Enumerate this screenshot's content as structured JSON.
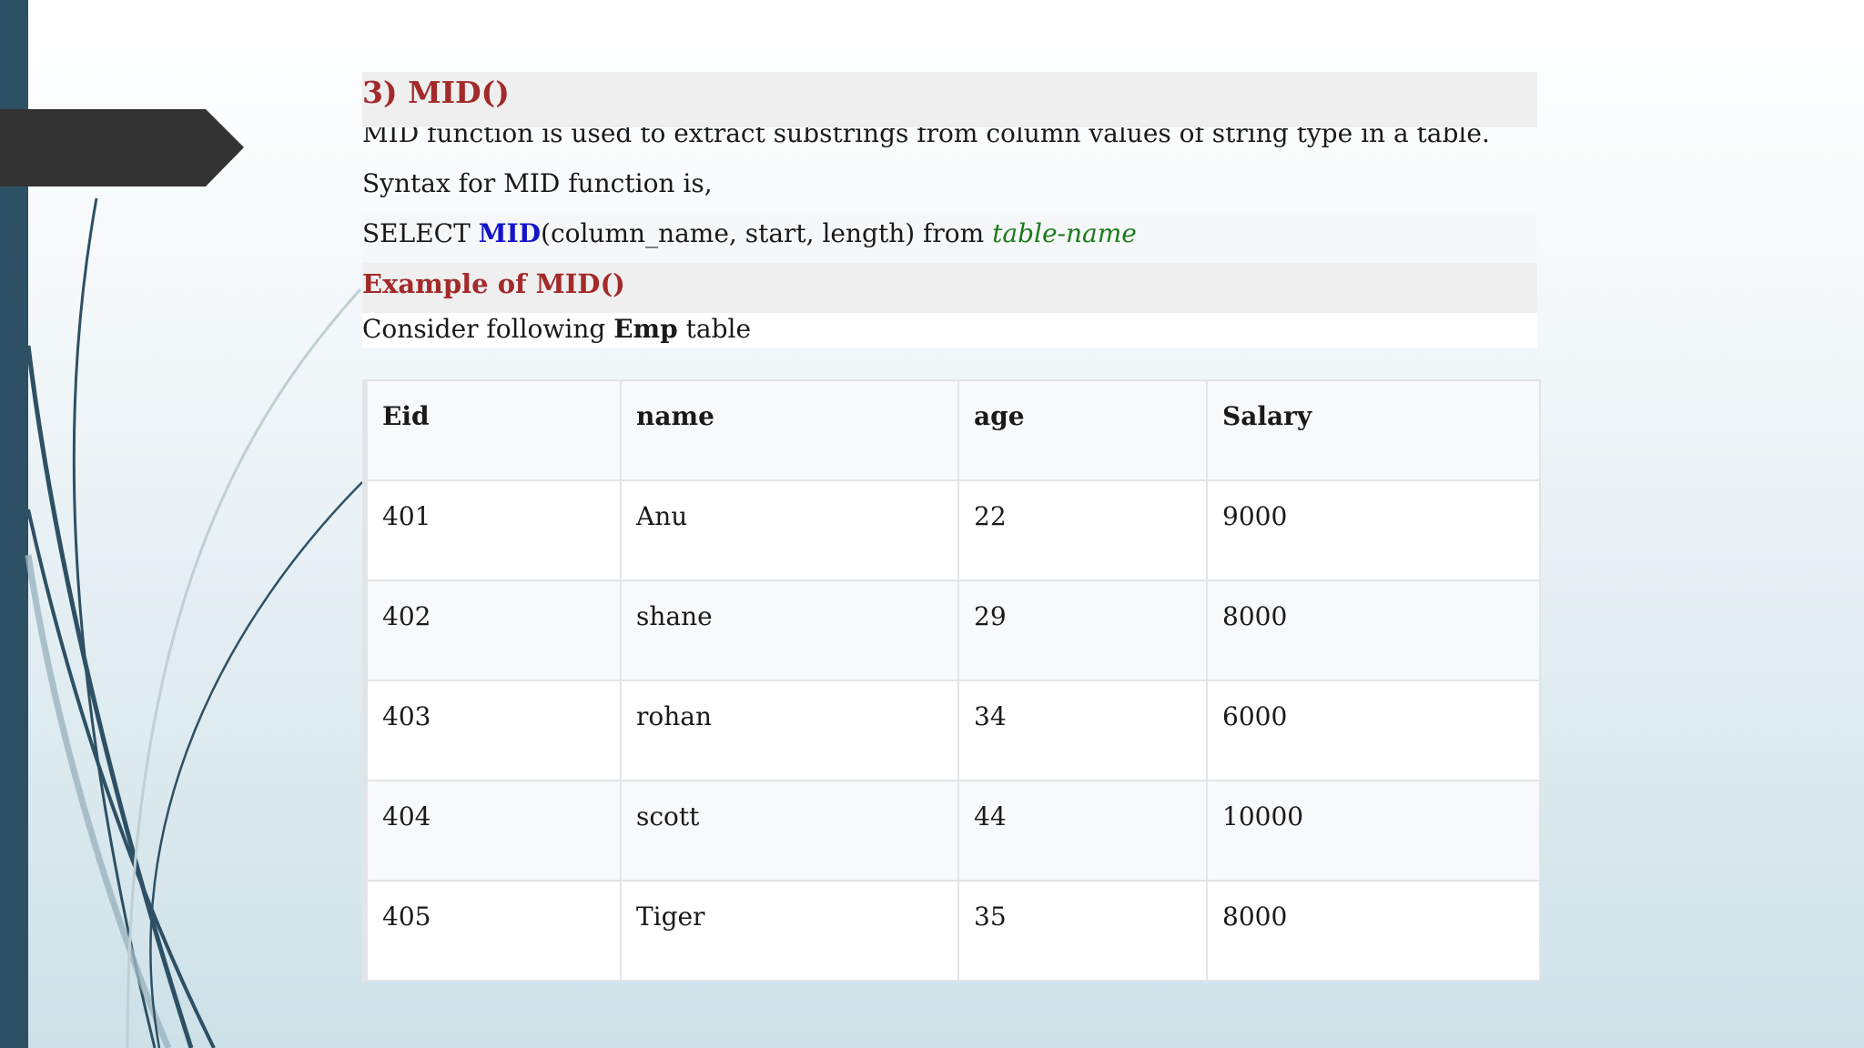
{
  "slide": {
    "heading": "3) MID()",
    "description": "MID function is used to extract substrings from column values of string type in a table.",
    "syntax_intro": "Syntax for MID function is,",
    "syntax": {
      "prefix": "SELECT ",
      "keyword": "MID",
      "args": "(column_name, start, length) from ",
      "table_placeholder": "table-name"
    },
    "example_heading": "Example of MID()",
    "consider": {
      "prefix": "Consider following ",
      "table_name": "Emp",
      "suffix": " table"
    }
  },
  "table": {
    "headers": [
      "Eid",
      "name",
      "age",
      "Salary"
    ],
    "rows": [
      [
        "401",
        "Anu",
        "22",
        "9000"
      ],
      [
        "402",
        "shane",
        "29",
        "8000"
      ],
      [
        "403",
        "rohan",
        "34",
        "6000"
      ],
      [
        "404",
        "scott",
        "44",
        "10000"
      ],
      [
        "405",
        "Tiger",
        "35",
        "8000"
      ]
    ]
  },
  "colors": {
    "heading": "#a32a2a",
    "keyword": "#1414c8",
    "placeholder": "#1b7a1b",
    "sidebar": "#2d5064"
  }
}
